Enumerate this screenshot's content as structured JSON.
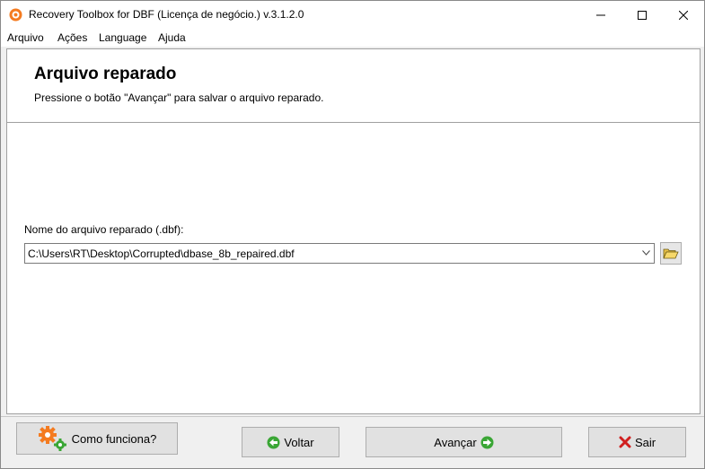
{
  "window": {
    "title": "Recovery Toolbox for DBF (Licença de negócio.) v.3.1.2.0"
  },
  "menu": {
    "items": [
      "Arquivo",
      "Ações",
      "Language",
      "Ajuda"
    ]
  },
  "header": {
    "title": "Arquivo reparado",
    "subtitle": "Pressione o botão \"Avançar\" para salvar o arquivo reparado."
  },
  "form": {
    "label": "Nome do arquivo reparado (.dbf):",
    "path_value": "C:\\Users\\RT\\Desktop\\Corrupted\\dbase_8b_repaired.dbf"
  },
  "buttons": {
    "help": "Como funciona?",
    "back": "Voltar",
    "next": "Avançar",
    "exit": "Sair"
  },
  "icons": {
    "app": "app-logo-icon",
    "browse": "open-folder-icon",
    "help": "gears-icon",
    "back": "back-arrow-icon",
    "next": "next-arrow-icon",
    "exit": "red-x-icon"
  },
  "colors": {
    "accent_orange": "#f47b20",
    "arrow_green": "#3aa635",
    "exit_red": "#d01f1f"
  }
}
